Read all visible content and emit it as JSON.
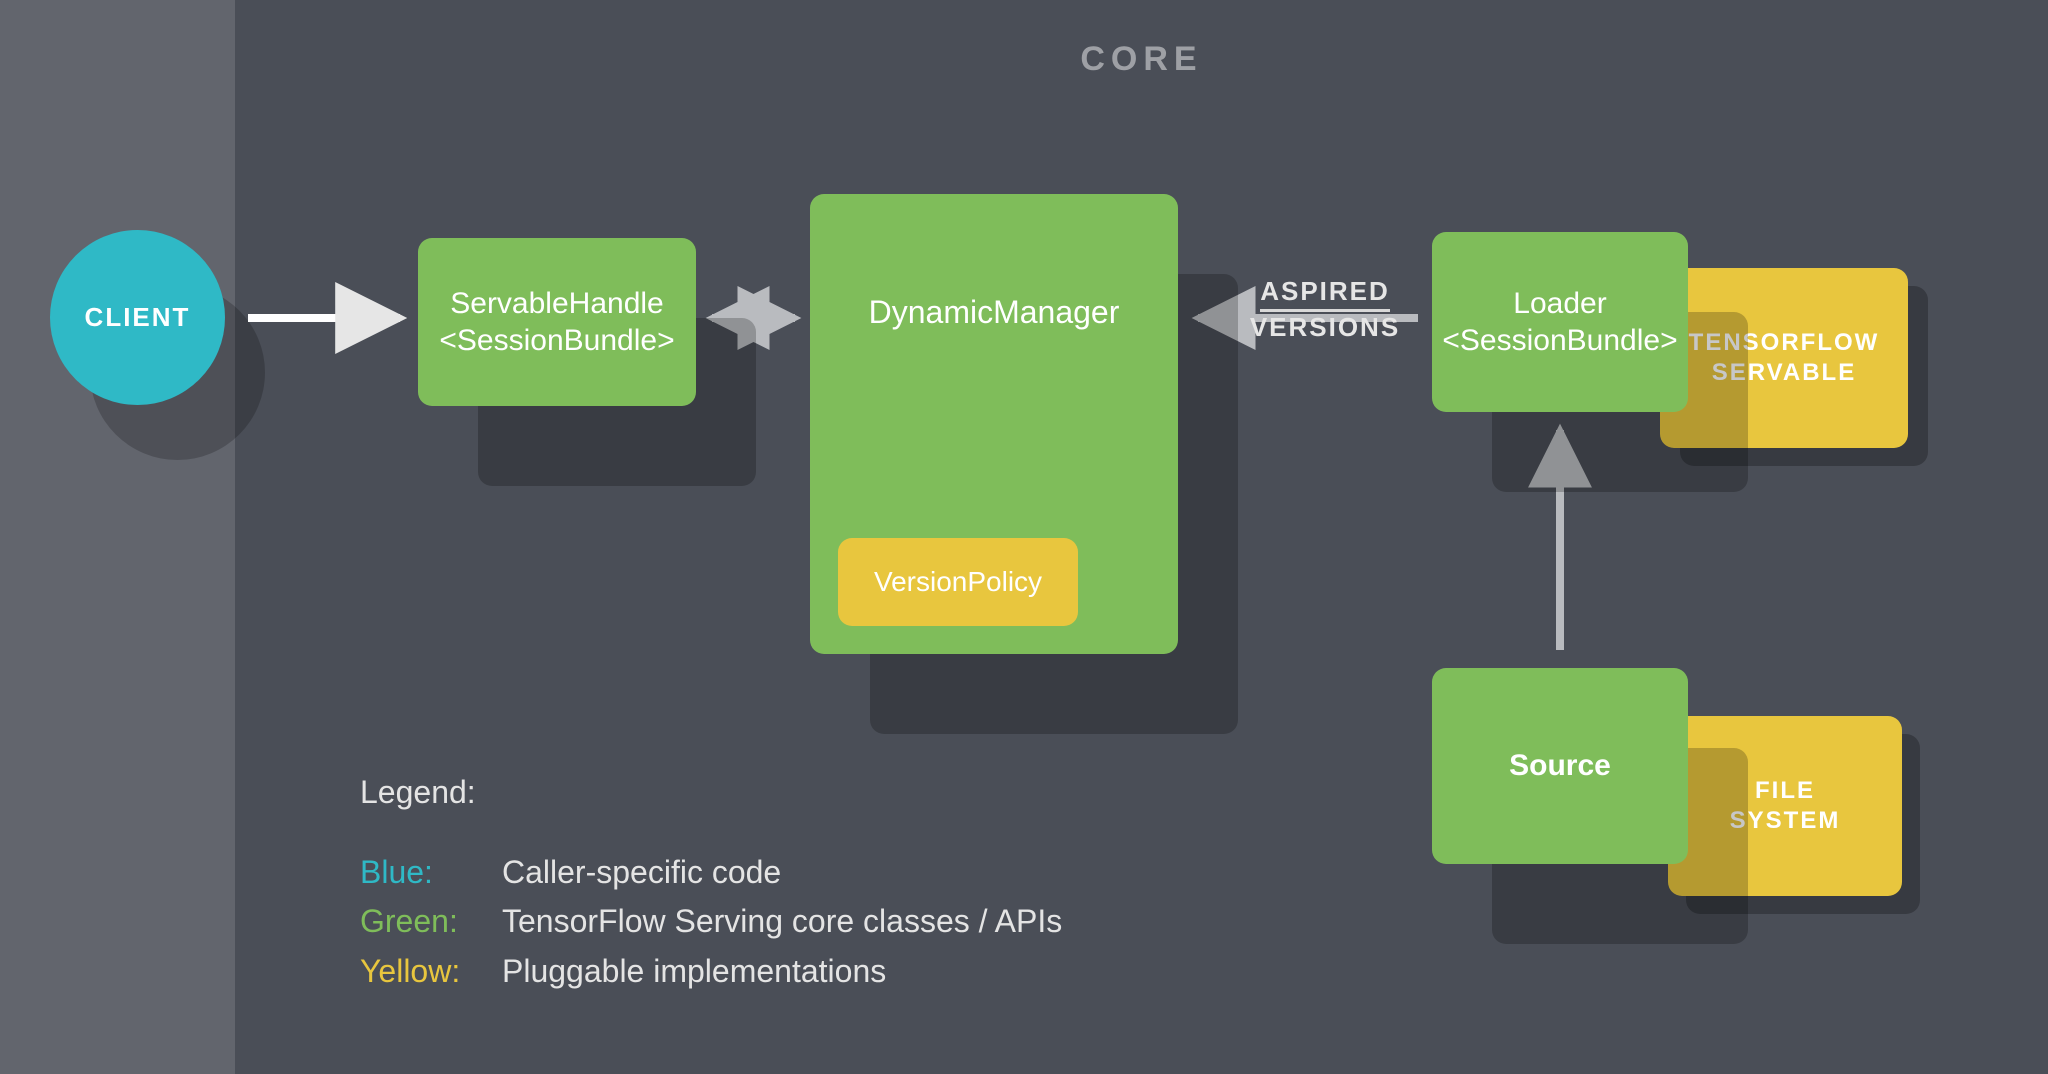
{
  "header": {
    "core_label": "CORE"
  },
  "client": {
    "label": "CLIENT"
  },
  "boxes": {
    "servable_handle_l1": "ServableHandle",
    "servable_handle_l2": "<SessionBundle>",
    "dynamic_manager": "DynamicManager",
    "version_policy": "VersionPolicy",
    "loader_l1": "Loader",
    "loader_l2": "<SessionBundle>",
    "tf_servable_l1": "TENSORFLOW",
    "tf_servable_l2": "SERVABLE",
    "source": "Source",
    "file_system_l1": "FILE",
    "file_system_l2": "SYSTEM"
  },
  "arrows": {
    "aspired_l1": "ASPIRED",
    "aspired_l2": "VERSIONS"
  },
  "legend": {
    "title": "Legend:",
    "blue_key": "Blue:",
    "blue_val": "Caller-specific code",
    "green_key": "Green:",
    "green_val": "TensorFlow Serving core classes / APIs",
    "yellow_key": "Yellow:",
    "yellow_val": "Pluggable implementations"
  },
  "colors": {
    "blue": "#2fb9c6",
    "green": "#7fbd5a",
    "yellow": "#e8c63e",
    "bg_core": "#4a4e57",
    "bg_left": "#62656d"
  }
}
